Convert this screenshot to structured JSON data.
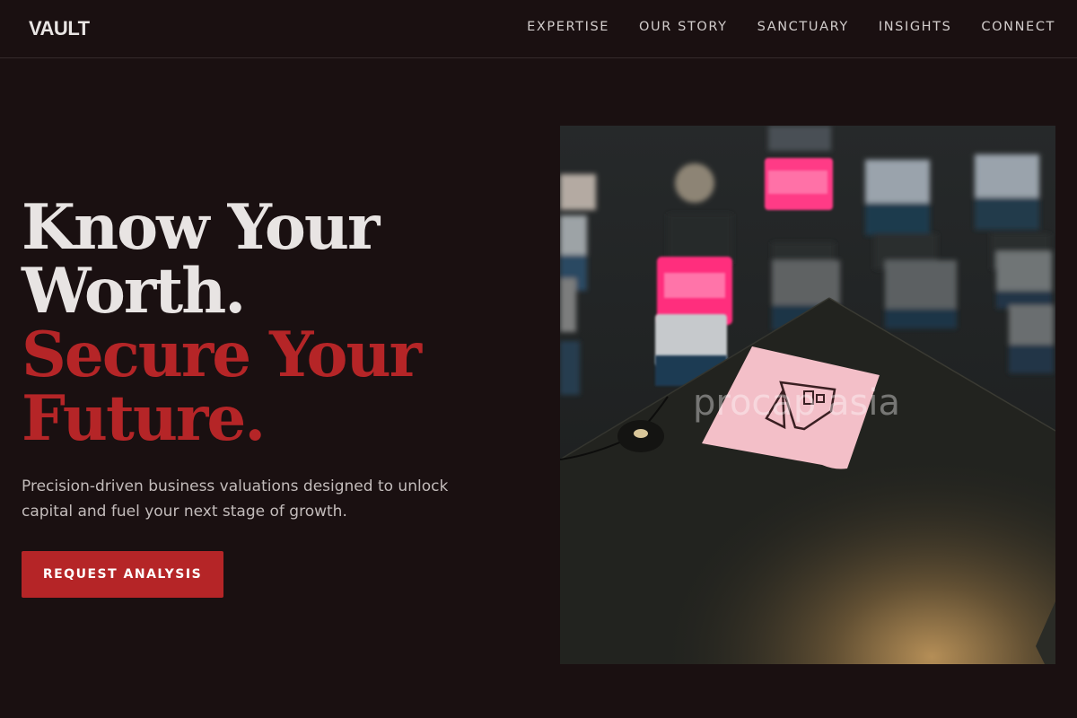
{
  "header": {
    "logo": "VAULT",
    "nav": [
      "EXPERTISE",
      "OUR STORY",
      "SANCTUARY",
      "INSIGHTS",
      "CONNECT"
    ]
  },
  "hero": {
    "headline_white": [
      "Know Your",
      "Worth."
    ],
    "headline_red": [
      "Secure Your",
      "Future."
    ],
    "subtitle": "Precision-driven business valuations designed to unlock capital and fuel your next stage of growth.",
    "cta_label": "REQUEST ANALYSIS",
    "image_watermark": "procap asia"
  },
  "colors": {
    "background": "#1a1011",
    "accent": "#b52527",
    "text": "#e8e4e3",
    "muted": "#c3bcbb"
  },
  "icons": [
    "pink-note-logo-icon"
  ]
}
